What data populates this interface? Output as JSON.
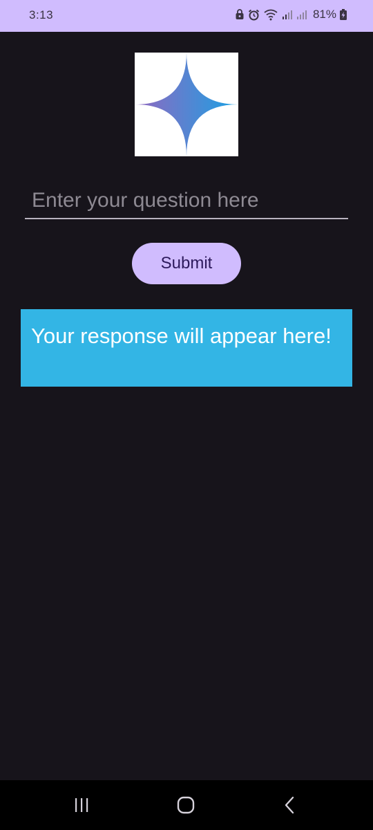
{
  "status_bar": {
    "time": "3:13",
    "battery_percent": "81%",
    "icons": [
      "lock-icon",
      "alarm-icon",
      "wifi-icon",
      "signal-icon",
      "signal-icon",
      "battery-charging-icon"
    ],
    "background": "#d0bcfe"
  },
  "logo": {
    "icon": "sparkle-star-icon",
    "gradient": [
      "#9168c0",
      "#1ba1e3"
    ]
  },
  "question_input": {
    "value": "",
    "placeholder": "Enter your question here"
  },
  "submit_button": {
    "label": "Submit",
    "color": "#d0bcfe"
  },
  "response": {
    "text": "Your response will appear here!",
    "background": "#33b5e5"
  },
  "nav_bar": {
    "buttons": [
      "recents-icon",
      "home-icon",
      "back-icon"
    ]
  }
}
